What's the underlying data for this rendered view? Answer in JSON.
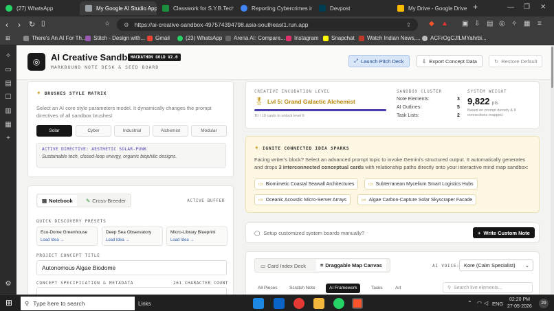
{
  "browser": {
    "tabs": [
      {
        "title": "(27) WhatsApp",
        "color": "#25d366"
      },
      {
        "title": "My Google AI Studio App",
        "color": "#9aa0a6"
      },
      {
        "title": "Classwork for S.Y.B.Tech (E",
        "color": "#1e8e3e"
      },
      {
        "title": "Reporting Cybercrimes in",
        "color": "#4285f4"
      },
      {
        "title": "Devpost",
        "color": "#003e54"
      },
      {
        "title": "My Drive - Google Drive",
        "color": "#fbbc04"
      }
    ],
    "new_tab": "+",
    "url": "https://ai-creative-sandbox-497574394798.asia-southeast1.run.app",
    "bookmarks": [
      "There's An AI For Th...",
      "Stitch - Design with...",
      "Gmail",
      "(23) WhatsApp",
      "Arena AI: Compare...",
      "Instagram",
      "Snapchat",
      "Watch Indian News,...",
      "ACFrOgCJfLMYahrbi..."
    ]
  },
  "app": {
    "title": "AI Creative Sandbox",
    "badge": "HACKATHON GOLD V2.0",
    "subtitle": "MARKBOUND NOTE DESK & SEED BOARD",
    "buttons": {
      "launch": "Launch Pitch Deck",
      "export": "Export Concept Data",
      "restore": "Restore Default"
    }
  },
  "brushes": {
    "title": "BRUSHES STYLE MATRIX",
    "description": "Select an AI core style parameters model. It dynamically changes the prompt directives of all sandbox brushes!",
    "options": [
      "Solar",
      "Cyber",
      "Industrial",
      "Alchemist",
      "Modular"
    ],
    "selected": "Solar",
    "directive_label": "ACTIVE DIRECTIVE: AESTHETIC SOLAR-PUNK",
    "directive_text": "Sustainable tech, closed-loop energy, organic biophilic designs."
  },
  "notebook": {
    "tabs": [
      "Notebook",
      "Cross-Breeder"
    ],
    "active_tab": "Notebook",
    "buffer_label": "ACTIVE BUFFER",
    "presets_label": "QUICK DISCOVERY PRESETS",
    "presets": [
      {
        "title": "Eco-Dome Greenhouse",
        "link": "Load Idea →"
      },
      {
        "title": "Deep Sea Observatory",
        "link": "Load Idea →"
      },
      {
        "title": "Micro-Library Blueprint",
        "link": "Load Idea →"
      }
    ],
    "concept_title_label": "PROJECT CONCEPT TITLE",
    "concept_title_value": "Autonomous Algae Biodome",
    "spec_label": "CONCEPT SPECIFICATION & METADATA",
    "char_count": "261 CHARACTER COUNT"
  },
  "stats": {
    "incubation_label": "CREATIVE INCUBATION LEVEL",
    "level": "Lvl 5: Grand Galactic Alchemist",
    "progress_fraction": 1.0,
    "progress_caption": "10 / 10 cards to unlock level 6",
    "cluster_label": "SANDBOX CLUSTER",
    "cluster": [
      {
        "label": "Note Elements:",
        "value": "3"
      },
      {
        "label": "AI Outlines:",
        "value": "5"
      },
      {
        "label": "Task Lists:",
        "value": "2"
      }
    ],
    "weight_label": "SYSTEM WEIGHT",
    "weight_value": "9,822",
    "weight_unit": "pts",
    "weight_caption": "Based on prompt density & 8 connections mapped."
  },
  "ignite": {
    "title": "IGNITE CONNECTED IDEA SPARKS",
    "text_before": "Facing writer's block? Select an advanced prompt topic to invoke Gemini's structured output. It automatically generates and drops ",
    "text_bold": "3 interconnected conceptual cards",
    "text_after": " with relationship paths directly onto your interactive mind map sandbox:",
    "chips": [
      "Biomimetic Coastal Seawall Architectures",
      "Subterranean Mycelium Smart Logistics Hubs",
      "Oceanic Acoustic Micro-Server Arrays",
      "Algae Carbon-Capture Solar Skyscraper Facade"
    ]
  },
  "custom_boards": {
    "prompt": "Setup customized system boards manually?",
    "button": "Write Custom Note"
  },
  "canvas": {
    "tabs": [
      "Card Index Deck",
      "Draggable Map Canvas"
    ],
    "active_tab": "Draggable Map Canvas",
    "voice_label": "AI VOICE:",
    "voice_value": "Kore (Calm Specialist)",
    "filters": [
      "All Pieces",
      "Scratch Note",
      "AI Framework",
      "Tasks",
      "Art"
    ],
    "active_filter": "AI Framework",
    "search_placeholder": "Search live elements..."
  },
  "taskbar": {
    "search_placeholder": "Type here to search",
    "links": "Links",
    "lang": "ENG",
    "time": "02:20 PM",
    "date": "27-05-2026",
    "notif": "29"
  },
  "colors": {
    "accent_purple": "#4a3fb0",
    "gold": "#c89b1e",
    "dark": "#161616"
  }
}
